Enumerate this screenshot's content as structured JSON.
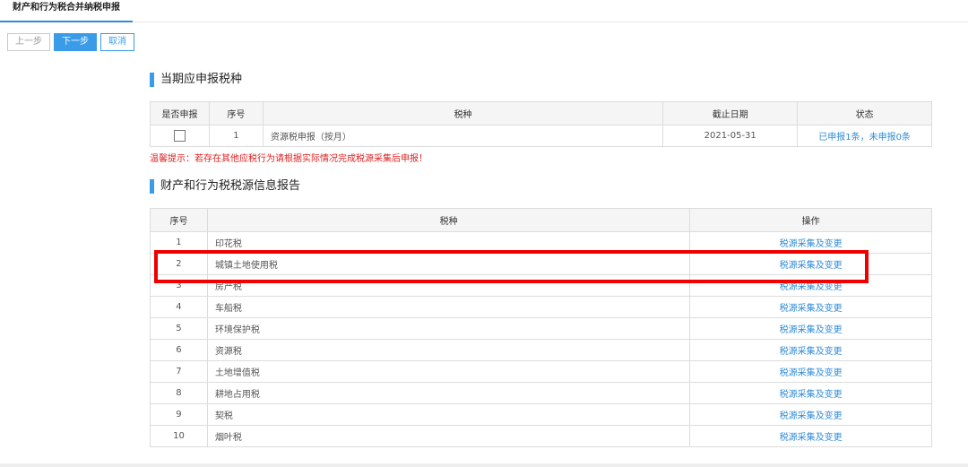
{
  "header": {
    "tab_label": "财产和行为税合并纳税申报"
  },
  "toolbar": {
    "prev_label": "上一步",
    "next_label": "下一步",
    "cancel_label": "取消"
  },
  "current_section": {
    "title": "当期应申报税种",
    "columns": [
      "是否申报",
      "序号",
      "税种",
      "截止日期",
      "状态"
    ],
    "rows": [
      {
        "declare_checked": false,
        "no": "1",
        "tax": "资源税申报（按月）",
        "deadline": "2021-05-31",
        "status": "已申报1条，未申报0条"
      }
    ],
    "tip": "温馨提示：若存在其他应税行为请根据实际情况完成税源采集后申报！"
  },
  "source_section": {
    "title": "财产和行为税税源信息报告",
    "columns": [
      "序号",
      "税种",
      "操作"
    ],
    "rows": [
      {
        "no": "1",
        "tax": "印花税",
        "action": "税源采集及变更"
      },
      {
        "no": "2",
        "tax": "城镇土地使用税",
        "action": "税源采集及变更"
      },
      {
        "no": "3",
        "tax": "房产税",
        "action": "税源采集及变更"
      },
      {
        "no": "4",
        "tax": "车船税",
        "action": "税源采集及变更"
      },
      {
        "no": "5",
        "tax": "环境保护税",
        "action": "税源采集及变更"
      },
      {
        "no": "6",
        "tax": "资源税",
        "action": "税源采集及变更"
      },
      {
        "no": "7",
        "tax": "土地增值税",
        "action": "税源采集及变更"
      },
      {
        "no": "8",
        "tax": "耕地占用税",
        "action": "税源采集及变更"
      },
      {
        "no": "9",
        "tax": "契税",
        "action": "税源采集及变更"
      },
      {
        "no": "10",
        "tax": "烟叶税",
        "action": "税源采集及变更"
      }
    ]
  },
  "colors": {
    "accent": "#3a9ce8",
    "link": "#2f8bd8",
    "warning": "#e02020",
    "highlight_box": "#ee0000"
  }
}
